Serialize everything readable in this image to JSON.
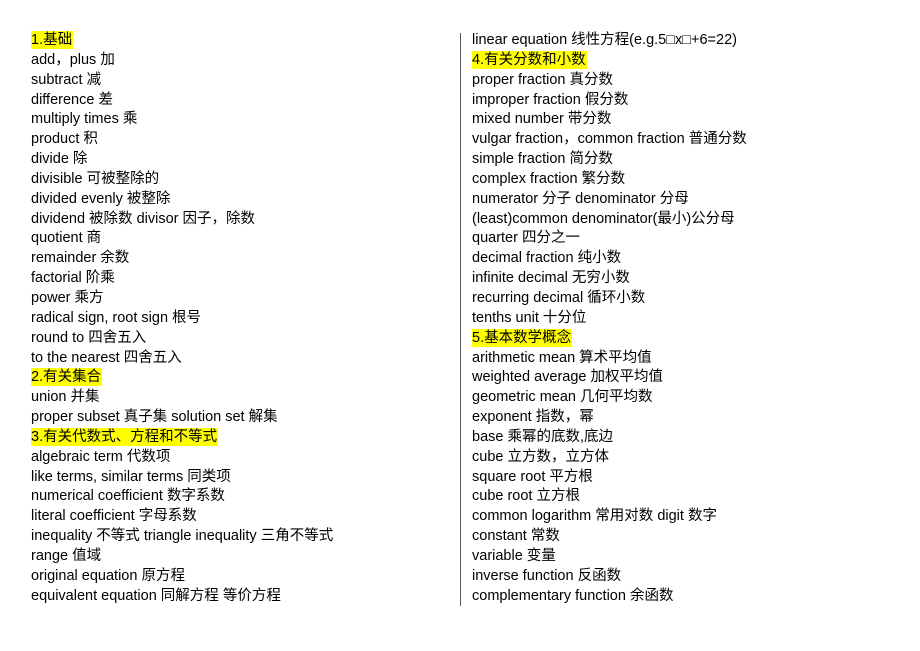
{
  "left_column": [
    {
      "type": "heading",
      "text": "1.基础"
    },
    {
      "type": "entry",
      "text": "add，plus 加"
    },
    {
      "type": "entry",
      "text": "subtract 减"
    },
    {
      "type": "entry",
      "text": "difference 差"
    },
    {
      "type": "entry",
      "text": "multiply times 乘"
    },
    {
      "type": "entry",
      "text": "product 积"
    },
    {
      "type": "entry",
      "text": "divide 除"
    },
    {
      "type": "entry",
      "text": "divisible 可被整除的"
    },
    {
      "type": "entry",
      "text": "divided evenly 被整除"
    },
    {
      "type": "entry",
      "text": "dividend 被除数  divisor 因子，除数"
    },
    {
      "type": "entry",
      "text": "quotient 商"
    },
    {
      "type": "entry",
      "text": "remainder 余数"
    },
    {
      "type": "entry",
      "text": "factorial 阶乘"
    },
    {
      "type": "entry",
      "text": "power 乘方"
    },
    {
      "type": "entry",
      "text": "radical sign, root sign 根号"
    },
    {
      "type": "entry",
      "text": "round to 四舍五入"
    },
    {
      "type": "entry",
      "text": "to the nearest 四舍五入"
    },
    {
      "type": "heading",
      "text": "2.有关集合"
    },
    {
      "type": "entry",
      "text": "union 并集"
    },
    {
      "type": "entry",
      "text": "proper subset 真子集  solution set 解集"
    },
    {
      "type": "heading",
      "text": "3.有关代数式、方程和不等式"
    },
    {
      "type": "entry",
      "text": "algebraic term 代数项"
    },
    {
      "type": "entry",
      "text": "like terms, similar terms 同类项"
    },
    {
      "type": "entry",
      "text": "numerical coefficient 数字系数"
    },
    {
      "type": "entry",
      "text": "literal coefficient 字母系数"
    },
    {
      "type": "entry",
      "text": "inequality 不等式  triangle inequality 三角不等式"
    },
    {
      "type": "entry",
      "text": "range 值域"
    },
    {
      "type": "entry",
      "text": "original equation 原方程"
    },
    {
      "type": "entry",
      "text": "equivalent equation 同解方程  等价方程"
    }
  ],
  "right_column": [
    {
      "type": "entry",
      "text": "linear equation 线性方程(e.g.5□x□+6=22)"
    },
    {
      "type": "heading",
      "text": "4.有关分数和小数"
    },
    {
      "type": "entry",
      "text": "proper fraction 真分数"
    },
    {
      "type": "entry",
      "text": "improper fraction 假分数"
    },
    {
      "type": "entry",
      "text": "mixed number 带分数"
    },
    {
      "type": "entry",
      "text": "vulgar fraction，common fraction 普通分数"
    },
    {
      "type": "entry",
      "text": "simple fraction 简分数"
    },
    {
      "type": "entry",
      "text": "complex fraction 繁分数"
    },
    {
      "type": "entry",
      "text": "numerator 分子  denominator 分母"
    },
    {
      "type": "entry",
      "text": "(least)common denominator(最小)公分母"
    },
    {
      "type": "entry",
      "text": "quarter 四分之一"
    },
    {
      "type": "entry",
      "text": "decimal fraction 纯小数"
    },
    {
      "type": "entry",
      "text": "infinite decimal 无穷小数"
    },
    {
      "type": "entry",
      "text": "recurring decimal 循环小数"
    },
    {
      "type": "entry",
      "text": "tenths unit  十分位"
    },
    {
      "type": "heading",
      "text": "5.基本数学概念"
    },
    {
      "type": "entry",
      "text": "arithmetic mean 算术平均值"
    },
    {
      "type": "entry",
      "text": "weighted average 加权平均值"
    },
    {
      "type": "entry",
      "text": "geometric mean 几何平均数"
    },
    {
      "type": "entry",
      "text": "exponent 指数，幂"
    },
    {
      "type": "entry",
      "text": "base 乘幂的底数,底边"
    },
    {
      "type": "entry",
      "text": "cube 立方数，立方体"
    },
    {
      "type": "entry",
      "text": "square root 平方根"
    },
    {
      "type": "entry",
      "text": "cube root 立方根"
    },
    {
      "type": "entry",
      "text": "common logarithm 常用对数  digit 数字"
    },
    {
      "type": "entry",
      "text": "constant 常数"
    },
    {
      "type": "entry",
      "text": "variable 变量"
    },
    {
      "type": "entry",
      "text": "inverse function 反函数"
    },
    {
      "type": "entry",
      "text": "complementary function 余函数"
    }
  ],
  "colors": {
    "highlight": "#ffff00",
    "divider": "#555555",
    "text": "#000000"
  }
}
